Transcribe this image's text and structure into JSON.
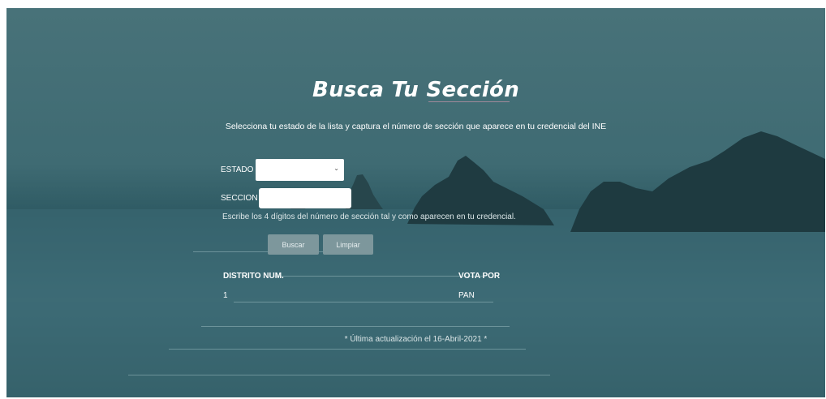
{
  "page": {
    "title": "Busca Tu Sección",
    "subtitle": "Selecciona tu estado de la lista y captura el número de sección que aparece en tu credencial del INE"
  },
  "form": {
    "estado_label": "ESTADO",
    "estado_value": "",
    "seccion_label": "SECCION",
    "seccion_value": "",
    "hint": "Escribe los 4 dígitos del número de sección tal y como aparecen en tu credencial.",
    "buscar_label": "Buscar",
    "limpiar_label": "Limpiar",
    "chevron_icon": "chevron-down-icon"
  },
  "results": {
    "headers": [
      "DISTRITO NUM.",
      "VOTA POR"
    ],
    "row": [
      "1",
      "PAN"
    ]
  },
  "footer": {
    "text": "* Última actualización el 16-Abril-2021 *"
  },
  "colors": {
    "background": "#3f6b73",
    "button": "#7d979c",
    "text": "#ffffff"
  }
}
